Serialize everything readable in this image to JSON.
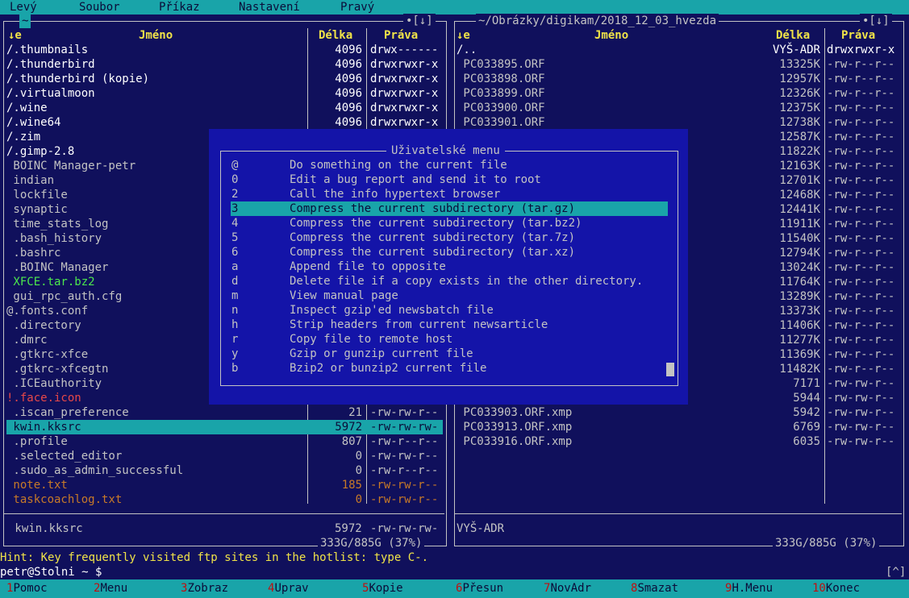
{
  "menu": [
    "Levý",
    "Soubor",
    "Příkaz",
    "Nastavení",
    "Pravý"
  ],
  "left": {
    "path": "~",
    "corner": "•[↓]",
    "sort": "↓e",
    "col_name": "Jméno",
    "col_size": "Délka",
    "col_perm": "Práva",
    "rows": [
      {
        "name": "/.thumbnails",
        "size": "4096",
        "perm": "drwx------",
        "color": "#ffffff"
      },
      {
        "name": "/.thunderbird",
        "size": "4096",
        "perm": "drwxrwxr-x",
        "color": "#ffffff"
      },
      {
        "name": "/.thunderbird (kopie)",
        "size": "4096",
        "perm": "drwxrwxr-x",
        "color": "#ffffff"
      },
      {
        "name": "/.virtualmoon",
        "size": "4096",
        "perm": "drwxrwxr-x",
        "color": "#ffffff"
      },
      {
        "name": "/.wine",
        "size": "4096",
        "perm": "drwxrwxr-x",
        "color": "#ffffff"
      },
      {
        "name": "/.wine64",
        "size": "4096",
        "perm": "drwxrwxr-x",
        "color": "#ffffff"
      },
      {
        "name": "/.zim",
        "size": "",
        "perm": "",
        "color": "#ffffff"
      },
      {
        "name": "/.gimp-2.8",
        "size": "",
        "perm": "",
        "color": "#ffffff"
      },
      {
        "name": " BOINC Manager-petr",
        "size": "",
        "perm": "",
        "color": "#c3c3c3"
      },
      {
        "name": " indian",
        "size": "",
        "perm": "",
        "color": "#c3c3c3"
      },
      {
        "name": " lockfile",
        "size": "",
        "perm": "",
        "color": "#c3c3c3"
      },
      {
        "name": " synaptic",
        "size": "",
        "perm": "",
        "color": "#c3c3c3"
      },
      {
        "name": " time_stats_log",
        "size": "",
        "perm": "",
        "color": "#c3c3c3"
      },
      {
        "name": " .bash_history",
        "size": "",
        "perm": "",
        "color": "#c3c3c3"
      },
      {
        "name": " .bashrc",
        "size": "",
        "perm": "",
        "color": "#c3c3c3"
      },
      {
        "name": " .BOINC Manager",
        "size": "",
        "perm": "",
        "color": "#c3c3c3"
      },
      {
        "name": " XFCE.tar.bz2",
        "size": "",
        "perm": "",
        "color": "#4ce84c"
      },
      {
        "name": " gui_rpc_auth.cfg",
        "size": "",
        "perm": "",
        "color": "#c3c3c3"
      },
      {
        "name": "@.fonts.conf",
        "size": "",
        "perm": "",
        "color": "#c3c3c3"
      },
      {
        "name": " .directory",
        "size": "",
        "perm": "",
        "color": "#c3c3c3"
      },
      {
        "name": " .dmrc",
        "size": "",
        "perm": "",
        "color": "#c3c3c3"
      },
      {
        "name": " .gtkrc-xfce",
        "size": "",
        "perm": "",
        "color": "#c3c3c3"
      },
      {
        "name": " .gtkrc-xfcegtn",
        "size": "",
        "perm": "",
        "color": "#c3c3c3"
      },
      {
        "name": " .ICEauthority",
        "size": "",
        "perm": "",
        "color": "#c3c3c3"
      },
      {
        "name": "!.face.icon",
        "size": "",
        "perm": "",
        "color": "#e84848"
      },
      {
        "name": " .iscan_preference",
        "size": "21",
        "perm": "-rw-rw-r--",
        "color": "#c3c3c3"
      },
      {
        "name": " kwin.kksrc",
        "size": "5972",
        "perm": "-rw-rw-rw-",
        "color": "#0b0b38",
        "selected": true
      },
      {
        "name": " .profile",
        "size": "807",
        "perm": "-rw-r--r--",
        "color": "#c3c3c3"
      },
      {
        "name": " .selected_editor",
        "size": "0",
        "perm": "-rw-rw-r--",
        "color": "#c3c3c3"
      },
      {
        "name": " .sudo_as_admin_successful",
        "size": "0",
        "perm": "-rw-r--r--",
        "color": "#c3c3c3"
      },
      {
        "name": " note.txt",
        "size": "185",
        "perm": "-rw-rw-r--",
        "color": "#c87a28"
      },
      {
        "name": " taskcoachlog.txt",
        "size": "0",
        "perm": "-rw-rw-r--",
        "color": "#c87a28"
      }
    ],
    "status_name": " kwin.kksrc",
    "status_size": "5972",
    "status_perm": "-rw-rw-rw-",
    "disk": "333G/885G (37%)"
  },
  "right": {
    "path": "~/Obrázky/digikam/2018_12_03_hvezda",
    "corner": "•[↓]",
    "sort": "↓e",
    "col_name": "Jméno",
    "col_size": "Délka",
    "col_perm": "Práva",
    "rows": [
      {
        "name": "/..",
        "size": "VYŠ-ADR",
        "perm": "drwxrwxr-x",
        "color": "#ffffff"
      },
      {
        "name": " PC033895.ORF",
        "size": "13325K",
        "perm": "-rw-r--r--",
        "color": "#c3c3c3"
      },
      {
        "name": " PC033898.ORF",
        "size": "12957K",
        "perm": "-rw-r--r--",
        "color": "#c3c3c3"
      },
      {
        "name": " PC033899.ORF",
        "size": "12326K",
        "perm": "-rw-r--r--",
        "color": "#c3c3c3"
      },
      {
        "name": " PC033900.ORF",
        "size": "12375K",
        "perm": "-rw-r--r--",
        "color": "#c3c3c3"
      },
      {
        "name": " PC033901.ORF",
        "size": "12738K",
        "perm": "-rw-r--r--",
        "color": "#c3c3c3"
      },
      {
        "name": "",
        "size": "12587K",
        "perm": "-rw-r--r--",
        "color": "#c3c3c3"
      },
      {
        "name": "",
        "size": "11822K",
        "perm": "-rw-r--r--",
        "color": "#c3c3c3"
      },
      {
        "name": "",
        "size": "12163K",
        "perm": "-rw-r--r--",
        "color": "#c3c3c3"
      },
      {
        "name": "",
        "size": "12701K",
        "perm": "-rw-r--r--",
        "color": "#c3c3c3"
      },
      {
        "name": "",
        "size": "12468K",
        "perm": "-rw-r--r--",
        "color": "#c3c3c3"
      },
      {
        "name": "",
        "size": "12441K",
        "perm": "-rw-r--r--",
        "color": "#c3c3c3"
      },
      {
        "name": "",
        "size": "11911K",
        "perm": "-rw-r--r--",
        "color": "#c3c3c3"
      },
      {
        "name": "",
        "size": "11540K",
        "perm": "-rw-r--r--",
        "color": "#c3c3c3"
      },
      {
        "name": "",
        "size": "12794K",
        "perm": "-rw-r--r--",
        "color": "#c3c3c3"
      },
      {
        "name": "",
        "size": "13024K",
        "perm": "-rw-r--r--",
        "color": "#c3c3c3"
      },
      {
        "name": "",
        "size": "11764K",
        "perm": "-rw-r--r--",
        "color": "#c3c3c3"
      },
      {
        "name": "",
        "size": "13289K",
        "perm": "-rw-r--r--",
        "color": "#c3c3c3"
      },
      {
        "name": "",
        "size": "13373K",
        "perm": "-rw-r--r--",
        "color": "#c3c3c3"
      },
      {
        "name": "",
        "size": "11406K",
        "perm": "-rw-r--r--",
        "color": "#c3c3c3"
      },
      {
        "name": "",
        "size": "11277K",
        "perm": "-rw-r--r--",
        "color": "#c3c3c3"
      },
      {
        "name": "",
        "size": "11369K",
        "perm": "-rw-r--r--",
        "color": "#c3c3c3"
      },
      {
        "name": "",
        "size": "11482K",
        "perm": "-rw-r--r--",
        "color": "#c3c3c3"
      },
      {
        "name": "",
        "size": "7171",
        "perm": "-rw-rw-r--",
        "color": "#c3c3c3"
      },
      {
        "name": "",
        "size": "5944",
        "perm": "-rw-rw-r--",
        "color": "#c3c3c3"
      },
      {
        "name": " PC033903.ORF.xmp",
        "size": "5942",
        "perm": "-rw-rw-r--",
        "color": "#c3c3c3"
      },
      {
        "name": " PC033913.ORF.xmp",
        "size": "6769",
        "perm": "-rw-rw-r--",
        "color": "#c3c3c3"
      },
      {
        "name": " PC033916.ORF.xmp",
        "size": "6035",
        "perm": "-rw-rw-r--",
        "color": "#c3c3c3"
      }
    ],
    "status_name": "VYŠ-ADR",
    "disk": "333G/885G (37%)"
  },
  "popup": {
    "title": "Uživatelské menu",
    "items": [
      {
        "key": "@",
        "label": "Do something on the current file"
      },
      {
        "key": "0",
        "label": "Edit a bug report and send it to root"
      },
      {
        "key": "2",
        "label": "Call the info hypertext browser"
      },
      {
        "key": "3",
        "label": "Compress the current subdirectory (tar.gz)",
        "selected": true
      },
      {
        "key": "4",
        "label": "Compress the current subdirectory (tar.bz2)"
      },
      {
        "key": "5",
        "label": "Compress the current subdirectory (tar.7z)"
      },
      {
        "key": "6",
        "label": "Compress the current subdirectory (tar.xz)"
      },
      {
        "key": "a",
        "label": "Append file to opposite"
      },
      {
        "key": "d",
        "label": "Delete file if a copy exists in the other directory."
      },
      {
        "key": "m",
        "label": "View manual page"
      },
      {
        "key": "n",
        "label": "Inspect gzip'ed newsbatch file"
      },
      {
        "key": "h",
        "label": "Strip headers from current newsarticle"
      },
      {
        "key": "r",
        "label": "Copy file to remote host"
      },
      {
        "key": "y",
        "label": "Gzip or gunzip current file"
      },
      {
        "key": "b",
        "label": "Bzip2 or bunzip2 current file"
      }
    ]
  },
  "hint": "Hint: Key frequently visited ftp sites in the hotlist: type C-.",
  "prompt": "petr@Stolni ~ $",
  "prompt_indicator": "[^]",
  "fkeys": [
    {
      "n": "1",
      "label": "Pomoc"
    },
    {
      "n": "2",
      "label": "Menu"
    },
    {
      "n": "3",
      "label": "Zobraz"
    },
    {
      "n": "4",
      "label": "Uprav"
    },
    {
      "n": "5",
      "label": "Kopie"
    },
    {
      "n": "6",
      "label": "Přesun"
    },
    {
      "n": "7",
      "label": "NovAdr"
    },
    {
      "n": "8",
      "label": "Smazat"
    },
    {
      "n": "9",
      "label": "H.Menu"
    },
    {
      "n": "10",
      "label": "Konec"
    }
  ]
}
